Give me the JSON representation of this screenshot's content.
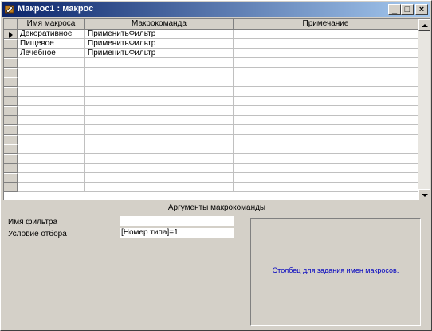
{
  "window": {
    "title": "Макрос1 : макрос",
    "buttons": {
      "minimize": "_",
      "maximize": "□",
      "close": "×"
    }
  },
  "grid": {
    "columns": [
      "Имя макроса",
      "Макрокоманда",
      "Примечание"
    ],
    "rows": [
      {
        "name": "Декоративное",
        "action": "ПрименитьФильтр",
        "note": "",
        "current": true
      },
      {
        "name": "Пищевое",
        "action": "ПрименитьФильтр",
        "note": "",
        "current": false
      },
      {
        "name": "Лечебное",
        "action": "ПрименитьФильтр",
        "note": "",
        "current": false
      }
    ],
    "empty_rows": 14
  },
  "arguments": {
    "title": "Аргументы макрокоманды",
    "fields": [
      {
        "label": "Имя фильтра",
        "value": ""
      },
      {
        "label": "Условие отбора",
        "value": "[Номер типа]=1"
      }
    ]
  },
  "help": {
    "text": "Столбец для задания имен макросов."
  },
  "colors": {
    "title_start": "#0a246a",
    "title_end": "#a6caf0",
    "help_text": "#0000c0",
    "face": "#d4d0c8"
  },
  "icons": {
    "app": "access-macro-icon",
    "current_row": "row-pointer-icon"
  }
}
